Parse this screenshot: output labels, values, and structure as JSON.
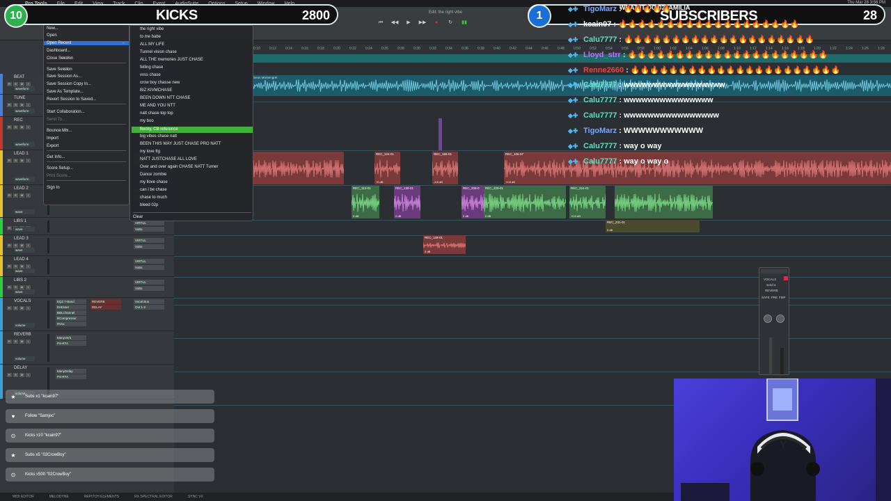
{
  "menubar": {
    "app": "Pro Tools",
    "items": [
      "File",
      "Edit",
      "View",
      "Track",
      "Clip",
      "Event",
      "AudioSuite",
      "Options",
      "Setup",
      "Window",
      "Help"
    ],
    "clock": "Thu Mar 28 3:56 PM"
  },
  "session": {
    "title": "Edit: the right vibe"
  },
  "file_menu": {
    "items": [
      {
        "label": "New...",
        "kbd": "",
        "state": "normal"
      },
      {
        "label": "Open",
        "kbd": "",
        "state": "normal"
      },
      {
        "label": "Open Recent",
        "kbd": "▸",
        "state": "highlight"
      },
      {
        "label": "Dashboard...",
        "kbd": "",
        "state": "normal"
      },
      {
        "label": "Close Session",
        "kbd": "⇧⌘W",
        "state": "normal"
      },
      {
        "label": "Save Session",
        "kbd": "⌘S",
        "state": "normal"
      },
      {
        "label": "Save Session As...",
        "kbd": "",
        "state": "normal"
      },
      {
        "label": "Save Session Copy In...",
        "kbd": "",
        "state": "normal"
      },
      {
        "label": "Save As Template...",
        "kbd": "",
        "state": "normal"
      },
      {
        "label": "Revert Session to Saved...",
        "kbd": "",
        "state": "normal"
      },
      {
        "label": "Start Collaboration...",
        "kbd": "",
        "state": "normal"
      },
      {
        "label": "Send To...",
        "kbd": "",
        "state": "dim"
      },
      {
        "label": "Bounce Mix...",
        "kbd": "⌥⌘B",
        "state": "normal"
      },
      {
        "label": "Import",
        "kbd": "▸",
        "state": "normal"
      },
      {
        "label": "Export",
        "kbd": "▸",
        "state": "normal"
      },
      {
        "label": "Get Info...",
        "kbd": "",
        "state": "normal"
      },
      {
        "label": "Score Setup...",
        "kbd": "",
        "state": "normal"
      },
      {
        "label": "Print Score...",
        "kbd": "",
        "state": "dim"
      },
      {
        "label": "Sign In",
        "kbd": "",
        "state": "normal"
      }
    ]
  },
  "recent_menu": {
    "items": [
      "the right vibe",
      "to me babe",
      "ALL MY LIFE",
      "Tunnel vision chase",
      "ALL THE memories JUST CHASE",
      "felling chase",
      "vvss chase",
      "crow boy chasse new",
      "BIZ KIVMCHASE",
      "BEEN DOWN NTT CHASE",
      "ME AND YOU NTT",
      "natt chase top top",
      "my boo",
      "Becky, CB reference",
      "big vibes chase natt",
      "BEEN THIS WAY JUST CHASE  PRO NATT",
      "my love ttg",
      "NATT JUSTCHASE ALL LOVE",
      "Over and over again CHASE NATT Turner",
      "Dance zombie",
      "my llove chase",
      "can i be chase",
      "chase to much",
      "bleed 02p"
    ],
    "selected_index": 13,
    "clear_label": "Clear"
  },
  "tracks": [
    {
      "name": "BEAT",
      "color": "#4a7fd6",
      "mode": "waveform"
    },
    {
      "name": "TUNE",
      "color": "#4a7fd6",
      "mode": "waveform"
    },
    {
      "name": "REC",
      "color": "#c0392b",
      "mode": "waveform"
    },
    {
      "name": "LEAD 1",
      "color": "#e5c12e",
      "mode": "waveform"
    },
    {
      "name": "LEAD 2",
      "color": "#e5c12e",
      "mode": "wave"
    },
    {
      "name": "LIBS 1",
      "color": "#2ecc40",
      "mode": "wave"
    },
    {
      "name": "LEAD 3",
      "color": "#e5c12e",
      "mode": "wave"
    },
    {
      "name": "LEAD 4",
      "color": "#e5c12e",
      "mode": "wave"
    },
    {
      "name": "LIBS 2",
      "color": "#2ecc40",
      "mode": "wave"
    },
    {
      "name": "VOCALS",
      "color": "#3aa0d6",
      "mode": "volume"
    },
    {
      "name": "REVERB",
      "color": "#3aa0d6",
      "mode": "volume"
    },
    {
      "name": "DELAY",
      "color": "#3aa0d6",
      "mode": "volume"
    }
  ],
  "inserts": {
    "vocals": [
      "EQ3 7-Band",
      "DeEsser",
      "BBLChannel",
      "RCompressor",
      "RVox"
    ],
    "vocals_sends": [
      "REVERB",
      "DELAY"
    ],
    "vocals_io": [
      "Vocal Bus",
      "Out 1-2"
    ],
    "reverb": [
      "ManyVerb",
      "PS-RTA"
    ],
    "delay": [
      "ManyDelay",
      "PS-RTA"
    ],
    "lead_io": [
      "VIRTUL",
      "VoBs"
    ]
  },
  "clips": [
    {
      "name": "REC_124-01",
      "db": "+0 dB"
    },
    {
      "name": "REC_166-01",
      "db": "-3.8 dB"
    },
    {
      "name": "REC_106-07",
      "db": "+2.8 dB"
    },
    {
      "name": "REC_113-01",
      "db": "0 dB"
    },
    {
      "name": "REC_130-01",
      "db": "0 dB"
    },
    {
      "name": "REC_208-0",
      "db": "0 dB"
    },
    {
      "name": "REC_220-01",
      "db": "0 dB"
    },
    {
      "name": "REC_224-01",
      "db": "+0.0 dB"
    },
    {
      "name": "REC_148-01",
      "db": "0 dB"
    },
    {
      "name": "REC_231-01",
      "db": "0 dB"
    },
    {
      "name": "Sean Montengret",
      "db": ""
    }
  ],
  "overlay": {
    "kicks": {
      "badge": "10",
      "label": "KICKS",
      "value": "2800",
      "badge_color": "#2bb24c"
    },
    "subs": {
      "badge": "1",
      "label": "SUBSCRIBERS",
      "value": "28",
      "badge_color": "#1a6fd6"
    },
    "subs_banner": "WHAT IT DO 02FAMILIA"
  },
  "chat": [
    {
      "user": "TigoMarz",
      "user_color": "#7aa7ff",
      "msg": "🔥🔥🔥🔥🔥"
    },
    {
      "user": "kcain97",
      "user_color": "#ffffff",
      "msg": "🔥🔥🔥🔥🔥🔥🔥🔥🔥🔥🔥🔥🔥🔥🔥🔥🔥🔥🔥"
    },
    {
      "user": "Calu7777",
      "user_color": "#5fe0c0",
      "msg": "🔥🔥🔥🔥🔥🔥🔥🔥🔥🔥🔥🔥🔥🔥🔥🔥🔥🔥🔥🔥"
    },
    {
      "user": "Lloyd_strr",
      "user_color": "#c86bff",
      "msg": "🔥🔥🔥🔥🔥🔥🔥🔥🔥🔥🔥🔥🔥🔥🔥🔥🔥🔥🔥🔥🔥"
    },
    {
      "user": "Renne2660",
      "user_color": "#ff3b3b",
      "msg": "🔥🔥🔥🔥🔥🔥🔥🔥🔥🔥🔥🔥🔥🔥🔥🔥🔥🔥🔥🔥🔥🔥"
    },
    {
      "user": "Calu7777",
      "user_color": "#5fe0c0",
      "msg": "wwwwwwwwwwwwwwwww"
    },
    {
      "user": "Calu7777",
      "user_color": "#5fe0c0",
      "msg": "wwwwwwwwwwwwwww"
    },
    {
      "user": "Calu7777",
      "user_color": "#5fe0c0",
      "msg": "wwwwwwwwwwwwwwww"
    },
    {
      "user": "TigoMarz",
      "user_color": "#7aa7ff",
      "msg": "WWWWWWWWWWW"
    },
    {
      "user": "Calu7777",
      "user_color": "#5fe0c0",
      "msg": "way o way"
    },
    {
      "user": "Calu7777",
      "user_color": "#5fe0c0",
      "msg": "way o way o"
    }
  ],
  "alerts": [
    {
      "icon": "★",
      "text": "Subs x1 \"kcain97\""
    },
    {
      "icon": "♥",
      "text": "Follow \"Samjoc\""
    },
    {
      "icon": "⊙",
      "text": "Kicks x10 \"kcain97\""
    },
    {
      "icon": "★",
      "text": "Subs x5 \"02CrowBoy\""
    },
    {
      "icon": "⊙",
      "text": "Kicks x500 \"02CrowBoy\""
    }
  ],
  "plugin": {
    "title": "VOCALS",
    "send": "send a",
    "bus": "REVERB",
    "btns": [
      "SAFE",
      "PRE",
      "FMP"
    ]
  },
  "bottom_bar": [
    "MIDI EDITOR",
    "MELODYNE",
    "REPITCH ELEMENTS",
    "RX SPECTRAL EDITOR",
    "SYNC VX"
  ],
  "ruler_ticks": [
    "0:10",
    "0:12",
    "0:14",
    "0:16",
    "0:18",
    "0:20",
    "0:22",
    "0:24",
    "0:26",
    "0:28",
    "0:30",
    "0:32",
    "0:34",
    "0:36",
    "0:38",
    "0:40",
    "0:42",
    "0:44",
    "0:46",
    "0:48",
    "0:50",
    "0:52",
    "0:54",
    "0:56",
    "0:58",
    "1:00",
    "1:02",
    "1:04",
    "1:06",
    "1:08",
    "1:10",
    "1:12",
    "1:14",
    "1:16",
    "1:18",
    "1:20",
    "1:22",
    "1:24",
    "1:26",
    "1:28"
  ]
}
